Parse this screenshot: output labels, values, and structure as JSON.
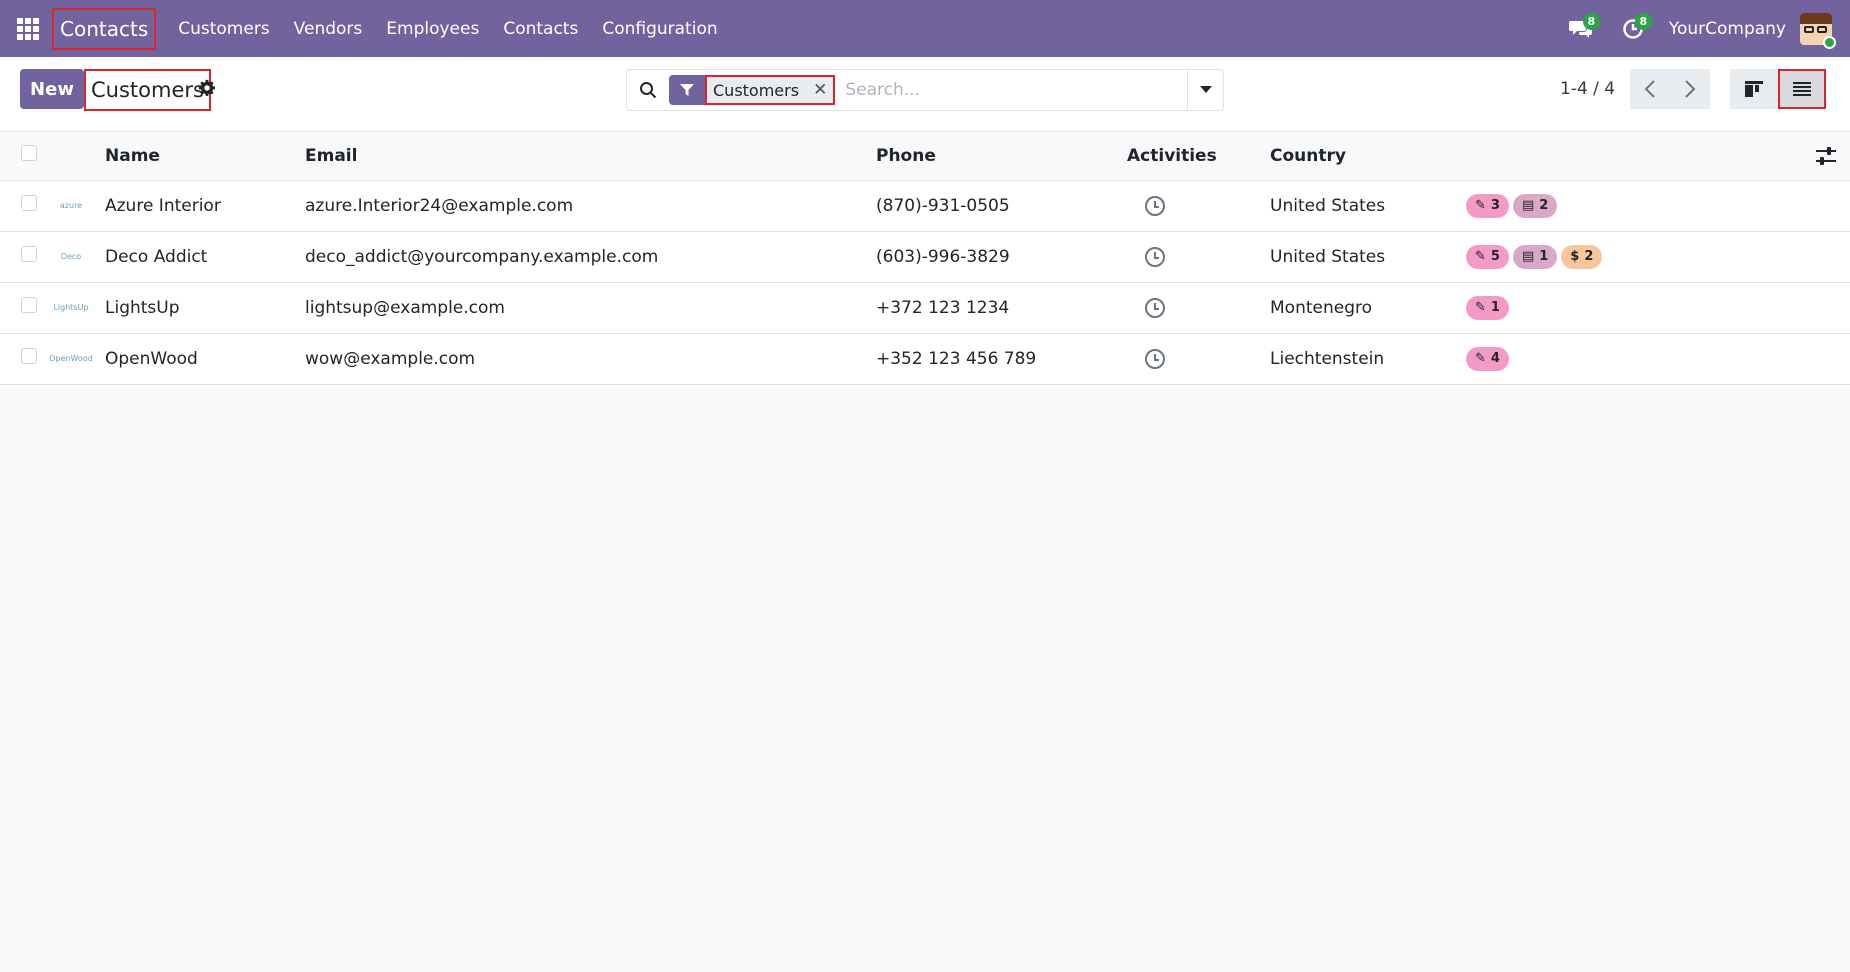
{
  "navbar": {
    "brand": "Contacts",
    "menu": [
      "Customers",
      "Vendors",
      "Employees",
      "Contacts",
      "Configuration"
    ],
    "messages_count": "8",
    "activities_count": "8",
    "company": "YourCompany"
  },
  "control": {
    "new_label": "New",
    "title": "Customers",
    "facet_label": "Customers",
    "search_placeholder": "Search...",
    "pager": "1-4 / 4"
  },
  "table": {
    "headers": {
      "name": "Name",
      "email": "Email",
      "phone": "Phone",
      "activities": "Activities",
      "country": "Country"
    },
    "rows": [
      {
        "logo": "azure",
        "name": "Azure Interior",
        "email": "azure.Interior24@example.com",
        "phone": "(870)-931-0505",
        "country": "United States",
        "badges": [
          {
            "type": "edit",
            "count": "3"
          },
          {
            "type": "card",
            "count": "2"
          }
        ]
      },
      {
        "logo": "Deco",
        "name": "Deco Addict",
        "email": "deco_addict@yourcompany.example.com",
        "phone": "(603)-996-3829",
        "country": "United States",
        "badges": [
          {
            "type": "edit",
            "count": "5"
          },
          {
            "type": "card",
            "count": "1"
          },
          {
            "type": "dollar",
            "count": "2"
          }
        ]
      },
      {
        "logo": "LightsUp",
        "name": "LightsUp",
        "email": "lightsup@example.com",
        "phone": "+372 123 1234",
        "country": "Montenegro",
        "badges": [
          {
            "type": "edit",
            "count": "1"
          }
        ]
      },
      {
        "logo": "OpenWood",
        "name": "OpenWood",
        "email": "wow@example.com",
        "phone": "+352 123 456 789",
        "country": "Liechtenstein",
        "badges": [
          {
            "type": "edit",
            "count": "4"
          }
        ]
      }
    ]
  },
  "colors": {
    "brand": "#71639e",
    "badge_green": "#28a745",
    "highlight": "#d9262c"
  }
}
